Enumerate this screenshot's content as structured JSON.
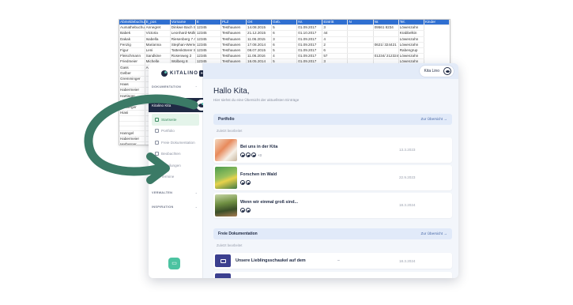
{
  "spreadsheet": {
    "columns": [
      "Abmeldebuchung",
      "E_pos",
      "Vorname",
      "E",
      "PLZ",
      "Ort",
      "Geb.",
      "Nr.",
      "Eintritt",
      "N",
      "Nr.",
      "Tel.",
      "Kinder"
    ],
    "rows": [
      [
        "Aumathebuchung",
        "Annegret",
        "Dinkwe Bach Str. 4",
        "12345",
        "Testhausen",
        "14.08.2015",
        "5",
        "01.09.2017",
        "3",
        "",
        "09561 8234",
        "Löwenzahn"
      ],
      [
        "Babek",
        "Victoria",
        "Leonhard-Müller-Str.",
        "12345",
        "Testhausen",
        "21.12.2015",
        "6",
        "01.10.2017",
        "44",
        "",
        "",
        "Krabbelkin"
      ],
      [
        "Dakak",
        "Isabella",
        "Riesenberg 7 A",
        "12345",
        "Testhausen",
        "11.06.2015",
        "3",
        "01.09.2017",
        "4",
        "",
        "",
        "Löwenzahn"
      ],
      [
        "Fenzig",
        "Marianna",
        "Stephan-Werner-Str. 26",
        "12345",
        "Testhausen",
        "17.08.2014",
        "6",
        "01.09.2017",
        "2",
        "",
        "0621/ 324421",
        "Löwenzahn"
      ],
      [
        "Figur",
        "Leni",
        "Tattenköterer Str. 32b",
        "12345",
        "Testhausen",
        "08.07.2015",
        "5",
        "01.09.2017",
        "6",
        "",
        "",
        "Rabengrup"
      ],
      [
        "Fleischmann",
        "Sandkine",
        "Rosenweg 2",
        "12345",
        "Testhausen",
        "11.06.2016",
        "4",
        "01.09.2017",
        "57",
        "",
        "01234/ 212324",
        "Löwenzahn"
      ],
      [
        "Friedmeier",
        "Michelle",
        "Wolberg 8",
        "12345",
        "Testhausen",
        "16.05.2014",
        "5",
        "01.09.2017",
        "3",
        "",
        "",
        "Löwenzahn"
      ],
      [
        "Gass",
        "Andrea",
        "",
        "12345",
        "Testhausen",
        "01.09.2020",
        "5",
        "01.08.2020",
        "74",
        "",
        "",
        "Löwenzahn"
      ],
      [
        "Gelber",
        "",
        "",
        "",
        "",
        "",
        "",
        "",
        "",
        "",
        "",
        ""
      ],
      [
        "Gremminger",
        "",
        "",
        "",
        "",
        "",
        "",
        "",
        "",
        "",
        "",
        ""
      ],
      [
        "Haas",
        "",
        "",
        "",
        "",
        "",
        "",
        "",
        "",
        "",
        "",
        ""
      ],
      [
        "Habermeier",
        "",
        "",
        "",
        "",
        "",
        "",
        "",
        "",
        "",
        "",
        ""
      ],
      [
        "Hartinger",
        "",
        "",
        "",
        "",
        "",
        "",
        "",
        "",
        "",
        "",
        ""
      ],
      [
        "Hoenzel",
        "",
        "",
        "",
        "",
        "",
        "",
        "",
        "",
        "",
        "",
        ""
      ],
      [
        "Herberger",
        "",
        "",
        "",
        "",
        "",
        "",
        "",
        "",
        "",
        "",
        ""
      ],
      [
        "Hiasi",
        "",
        "",
        "",
        "",
        "",
        "",
        "",
        "",
        "",
        "",
        ""
      ],
      [
        "",
        "",
        "",
        "",
        "",
        "",
        "",
        "",
        "",
        "",
        "",
        ""
      ],
      [
        "",
        "",
        "",
        "",
        "",
        "",
        "",
        "",
        "",
        "",
        "",
        ""
      ],
      [
        "",
        "",
        "",
        "",
        "",
        "",
        "",
        "",
        "",
        "",
        "",
        ""
      ],
      [
        "Hanngel",
        "",
        "",
        "",
        "",
        "",
        "",
        "",
        "",
        "",
        "",
        ""
      ],
      [
        "Habermeier",
        "",
        "",
        "",
        "",
        "",
        "",
        "",
        "",
        "",
        "",
        ""
      ],
      [
        "Herberger",
        "",
        "",
        "",
        "",
        "",
        "",
        "",
        "",
        "",
        "",
        ""
      ],
      [
        "Hiasi",
        "",
        "",
        "",
        "",
        "",
        "",
        "",
        "",
        "",
        "",
        ""
      ],
      [
        "Häflinger",
        "",
        "",
        "",
        "",
        "",
        "",
        "",
        "",
        "",
        "",
        ""
      ]
    ]
  },
  "app": {
    "brand": "KITALINO",
    "collapse_icon": "panel-collapse-icon",
    "sidebar": {
      "documentation_label": "DOKUMENTATION",
      "user_name": "Kitalino Kita",
      "nav": [
        {
          "label": "Startseite",
          "icon": "home-icon",
          "active": true
        },
        {
          "label": "Portfolio",
          "icon": "image-icon",
          "active": false
        },
        {
          "label": "Freie Dokumentation",
          "icon": "grid-icon",
          "active": false
        },
        {
          "label": "Beobachten",
          "icon": "document-icon",
          "active": false
        },
        {
          "label": "Mitteilungen",
          "icon": "message-icon",
          "active": false
        },
        {
          "label": "Termine",
          "icon": "calendar-icon",
          "active": false
        }
      ],
      "manage_label": "VERWALTEN",
      "inspiration_label": "INSPIRATION"
    },
    "topbar": {
      "account_label": "Kita Lino"
    },
    "greeting": "Hallo Kita,",
    "greeting_sub": "Hier siehst du eine Übersicht der aktuellsten Einträge",
    "portfolio": {
      "title": "Portfolio",
      "overview_link": "Zur Übersicht →",
      "recent_label": "Zuletzt bearbeitet",
      "items": [
        {
          "title": "Bei uns in der Kita",
          "date": "13.3.2023",
          "extra_count": "+3"
        },
        {
          "title": "Forschen im Wald",
          "date": "22.9.2023",
          "extra_count": ""
        },
        {
          "title": "Wenn wir einmal groß sind...",
          "date": "18.3.2024",
          "extra_count": ""
        }
      ]
    },
    "free_docs": {
      "title": "Freie Dokumentation",
      "overview_link": "Zur Übersicht →",
      "recent_label": "Zuletzt bearbeitet",
      "items": [
        {
          "title": "Unsere Lieblingsschaukel auf dem",
          "dash": "–",
          "date": "18.3.2024"
        }
      ]
    }
  },
  "colors": {
    "navy": "#1f2a44",
    "mint": "#4cc3a1",
    "arrow": "#3b7a66",
    "active_bg": "#e4f4ea",
    "section_bg": "#e1eaf9"
  }
}
